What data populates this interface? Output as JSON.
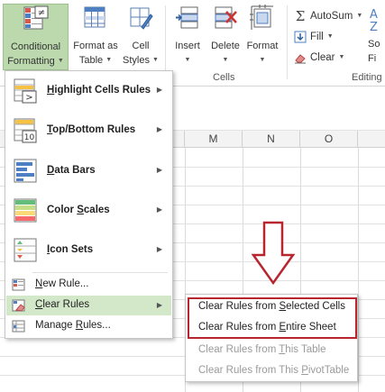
{
  "ribbon": {
    "conditional_formatting": {
      "line1": "Conditional",
      "line2": "Formatting"
    },
    "format_as_table": {
      "line1": "Format as",
      "line2": "Table"
    },
    "cell_styles": {
      "line1": "Cell",
      "line2": "Styles"
    },
    "insert": "Insert",
    "delete": "Delete",
    "format": "Format",
    "cells_group": "Cells",
    "autosum": "AutoSum",
    "fill": "Fill",
    "clear": "Clear",
    "editing_group": "Editing",
    "sort_partial": "So",
    "filter_partial": "Fi"
  },
  "columns": [
    "M",
    "N",
    "O"
  ],
  "cf_menu": {
    "highlight": {
      "pre": "",
      "key": "H",
      "post": "ighlight Cells Rules"
    },
    "topbottom": {
      "pre": "",
      "key": "T",
      "post": "op/Bottom Rules"
    },
    "databars": {
      "pre": "",
      "key": "D",
      "post": "ata Bars"
    },
    "colorscales": {
      "pre": "Color ",
      "key": "S",
      "post": "cales"
    },
    "iconsets": {
      "pre": "",
      "key": "I",
      "post": "con Sets"
    },
    "newrule": {
      "pre": "",
      "key": "N",
      "post": "ew Rule..."
    },
    "clearrules": {
      "pre": "",
      "key": "C",
      "post": "lear Rules"
    },
    "managerules": {
      "pre": "Manage ",
      "key": "R",
      "post": "ules..."
    }
  },
  "clear_submenu": {
    "selected": {
      "pre": "Clear Rules from ",
      "key": "S",
      "post": "elected Cells"
    },
    "entire": {
      "pre": "Clear Rules from ",
      "key": "E",
      "post": "ntire Sheet"
    },
    "table": {
      "pre": "Clear Rules from ",
      "key": "T",
      "post": "his Table"
    },
    "pivot": {
      "pre": "Clear Rules from This ",
      "key": "P",
      "post": "ivotTable"
    }
  },
  "colors": {
    "active_button": "#bcd9ae",
    "hover_item": "#d3e7c9",
    "highlight_box": "#b8252e",
    "arrow": "#b8252e"
  }
}
